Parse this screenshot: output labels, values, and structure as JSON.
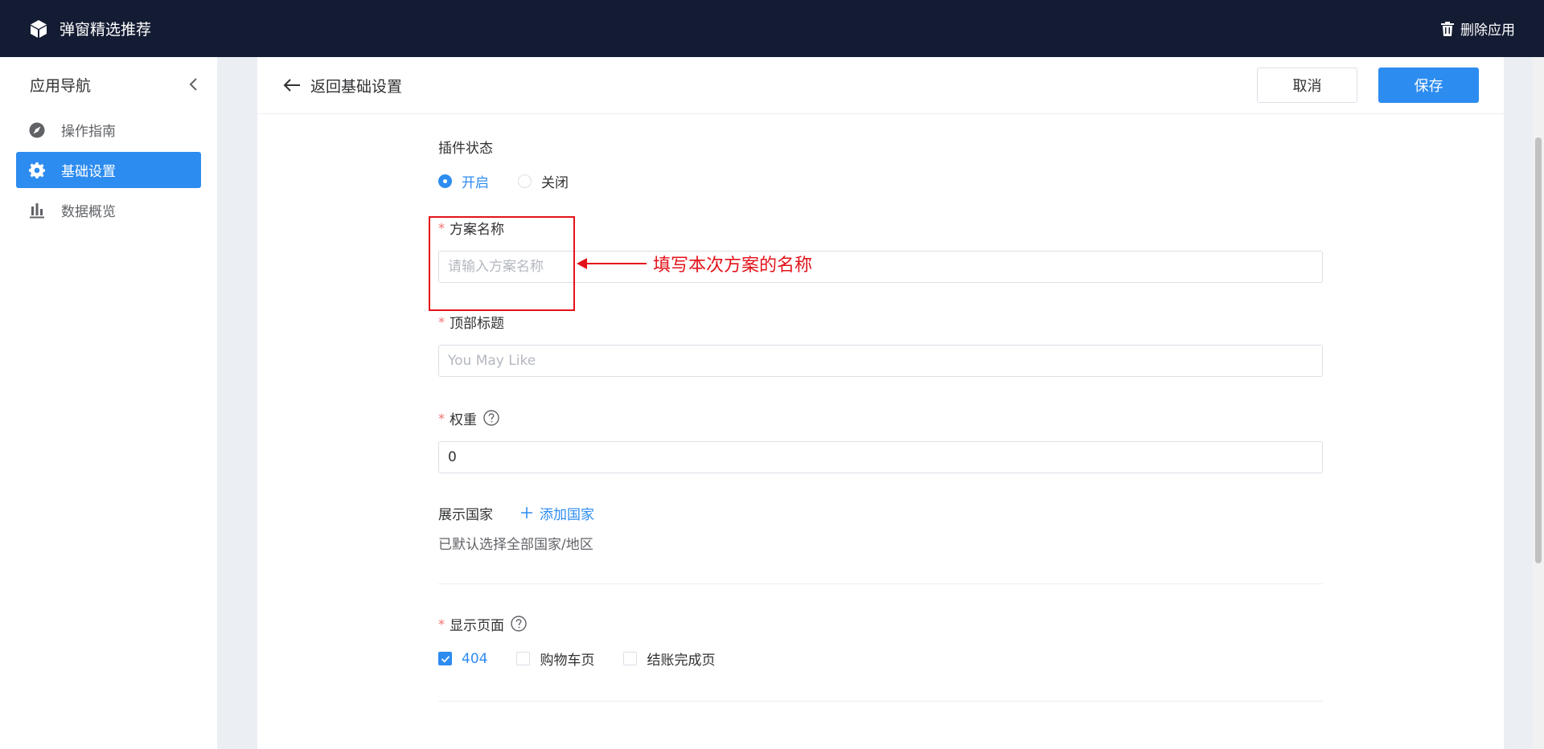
{
  "topbar": {
    "app_title": "弹窗精选推荐",
    "delete_label": "删除应用"
  },
  "sidebar": {
    "header": "应用导航",
    "items": [
      {
        "label": "操作指南",
        "icon": "compass-icon",
        "active": false
      },
      {
        "label": "基础设置",
        "icon": "gear-icon",
        "active": true
      },
      {
        "label": "数据概览",
        "icon": "bar-chart-icon",
        "active": false
      }
    ]
  },
  "content": {
    "back_label": "返回基础设置",
    "cancel_label": "取消",
    "save_label": "保存"
  },
  "form": {
    "plugin_status": {
      "label": "插件状态",
      "options": [
        "开启",
        "关闭"
      ],
      "selected": "开启"
    },
    "plan_name": {
      "required_mark": "*",
      "label": "方案名称",
      "placeholder": "请输入方案名称",
      "value": ""
    },
    "top_title": {
      "required_mark": "*",
      "label": "顶部标题",
      "placeholder": "You May Like",
      "value": ""
    },
    "weight": {
      "required_mark": "*",
      "label": "权重",
      "value": "0"
    },
    "countries": {
      "label": "展示国家",
      "add_label": "添加国家",
      "hint": "已默认选择全部国家/地区"
    },
    "display_pages": {
      "required_mark": "*",
      "label": "显示页面",
      "options": [
        {
          "label": "404",
          "checked": true
        },
        {
          "label": "购物车页",
          "checked": false
        },
        {
          "label": "结账完成页",
          "checked": false
        }
      ]
    }
  },
  "annotation": {
    "text": "填写本次方案的名称",
    "color": "#e3131b"
  },
  "colors": {
    "accent": "#2d8cf0",
    "topbar_bg": "#141c33"
  }
}
